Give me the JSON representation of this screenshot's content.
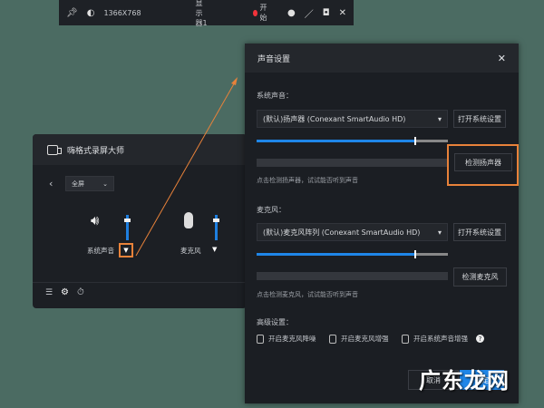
{
  "toolbar": {
    "resolution": "1366X768",
    "display": "显示器1",
    "start": "开始",
    "icons": [
      "pin-icon",
      "contrast-icon",
      "record-dot-icon",
      "bell-icon",
      "pen-icon",
      "camera-icon",
      "close-icon"
    ]
  },
  "main": {
    "title": "嗨格式录屏大师",
    "mode": "全屏",
    "system_sound": "系统声音",
    "microphone": "麦克风",
    "system_volume": 0.85,
    "mic_volume": 0.85
  },
  "settings": {
    "title": "声音设置",
    "system_label": "系统声音：",
    "speaker_device": "(默认)扬声器 (Conexant SmartAudio HD)",
    "open_system_settings": "打开系统设置",
    "test_speaker": "检测扬声器",
    "speaker_hint": "点击检测扬声器，试试能否听到声音",
    "speaker_volume": 0.83,
    "mic_label": "麦克风：",
    "mic_device": "(默认)麦克风阵列 (Conexant SmartAudio HD)",
    "open_system_settings_2": "打开系统设置",
    "test_mic": "检测麦克风",
    "mic_hint": "点击检测麦克风，试试能否听到声音",
    "mic_volume": 0.83,
    "advanced_label": "高级设置：",
    "options": [
      "开启麦克风降噪",
      "开启麦克风增强",
      "开启系统声音增强"
    ],
    "cancel": "取消",
    "ok": "确定"
  },
  "watermark": "广东龙网",
  "colors": {
    "accent": "#1f86e8",
    "highlight": "#e8823a",
    "background": "#4b6b62"
  }
}
